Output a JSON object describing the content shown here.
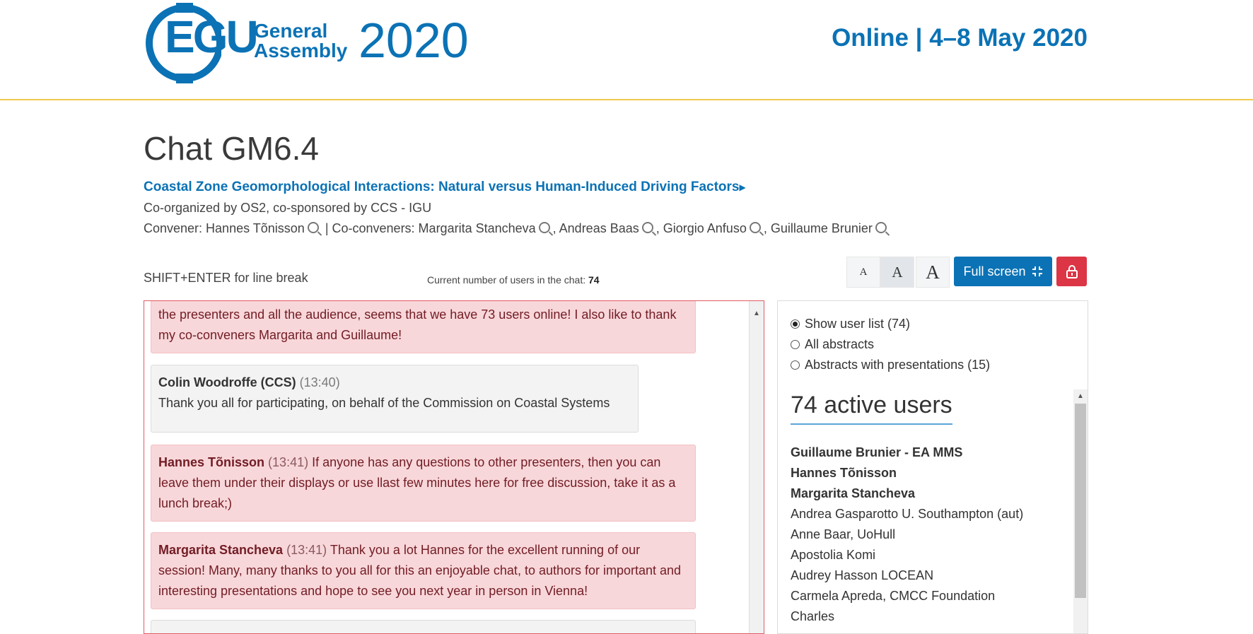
{
  "header": {
    "logo_egu": "EGU",
    "logo_line1": "General",
    "logo_line2": "Assembly",
    "logo_year": "2020",
    "right_text": "Online | 4–8 May 2020"
  },
  "page": {
    "title": "Chat GM6.4",
    "session_link": "Coastal Zone Geomorphological Interactions: Natural versus Human-Induced Driving Factors",
    "coorganized": "Co-organized by OS2, co-sponsored by CCS - IGU",
    "convener_label": "Convener: Hannes Tõnisson",
    "coconveners_label": "| Co-conveners: Margarita Stancheva",
    "coconvener_2": ", Andreas Baas",
    "coconvener_3": ", Giorgio Anfuso",
    "coconvener_4": ", Guillaume Brunier"
  },
  "toolbar": {
    "hint": "SHIFT+ENTER for line break",
    "user_count_label": "Current number of users in the chat:",
    "user_count_value": "74",
    "font_small": "A",
    "font_medium": "A",
    "font_large": "A",
    "fullscreen_label": "Full screen"
  },
  "chat": {
    "messages": [
      {
        "author": "",
        "time": "",
        "text": "the presenters and all the audience, seems that we have 73 users online! I also like to thank my co-conveners Margarita and Guillaume!"
      },
      {
        "author": "Colin Woodroffe (CCS)",
        "time": "(13:40)",
        "text": "Thank you all for participating, on behalf of the Commission on Coastal Systems"
      },
      {
        "author": "Hannes Tõnisson",
        "time": "(13:41)",
        "text": "If anyone has any questions to other presenters, then you can leave them under their displays or use llast few minutes here for free discussion, take it as a lunch break;)"
      },
      {
        "author": "Margarita Stancheva",
        "time": "(13:41)",
        "text": "Thank you a lot Hannes for the excellent running of our session! Many, many thanks to you all for this an enjoyable chat, to authors for important and interesting presentations and hope to see you next year in person in Vienna!"
      }
    ]
  },
  "sidebar": {
    "options": [
      "Show user list (74)",
      "All abstracts",
      "Abstracts with presentations (15)"
    ],
    "heading": "74 active users",
    "users_bold": [
      "Guillaume Brunier - EA MMS",
      "Hannes Tõnisson",
      "Margarita Stancheva"
    ],
    "users": [
      "Andrea Gasparotto U. Southampton (aut)",
      "Anne Baar, UoHull",
      "Apostolia Komi",
      "Audrey Hasson LOCEAN",
      "Carmela Apreda, CMCC Foundation",
      "Charles"
    ]
  },
  "colors": {
    "brand_blue": "#0b72b5",
    "header_border": "#f2c94c",
    "lock_red": "#dc3545",
    "pink_msg": "#f8d7da"
  }
}
